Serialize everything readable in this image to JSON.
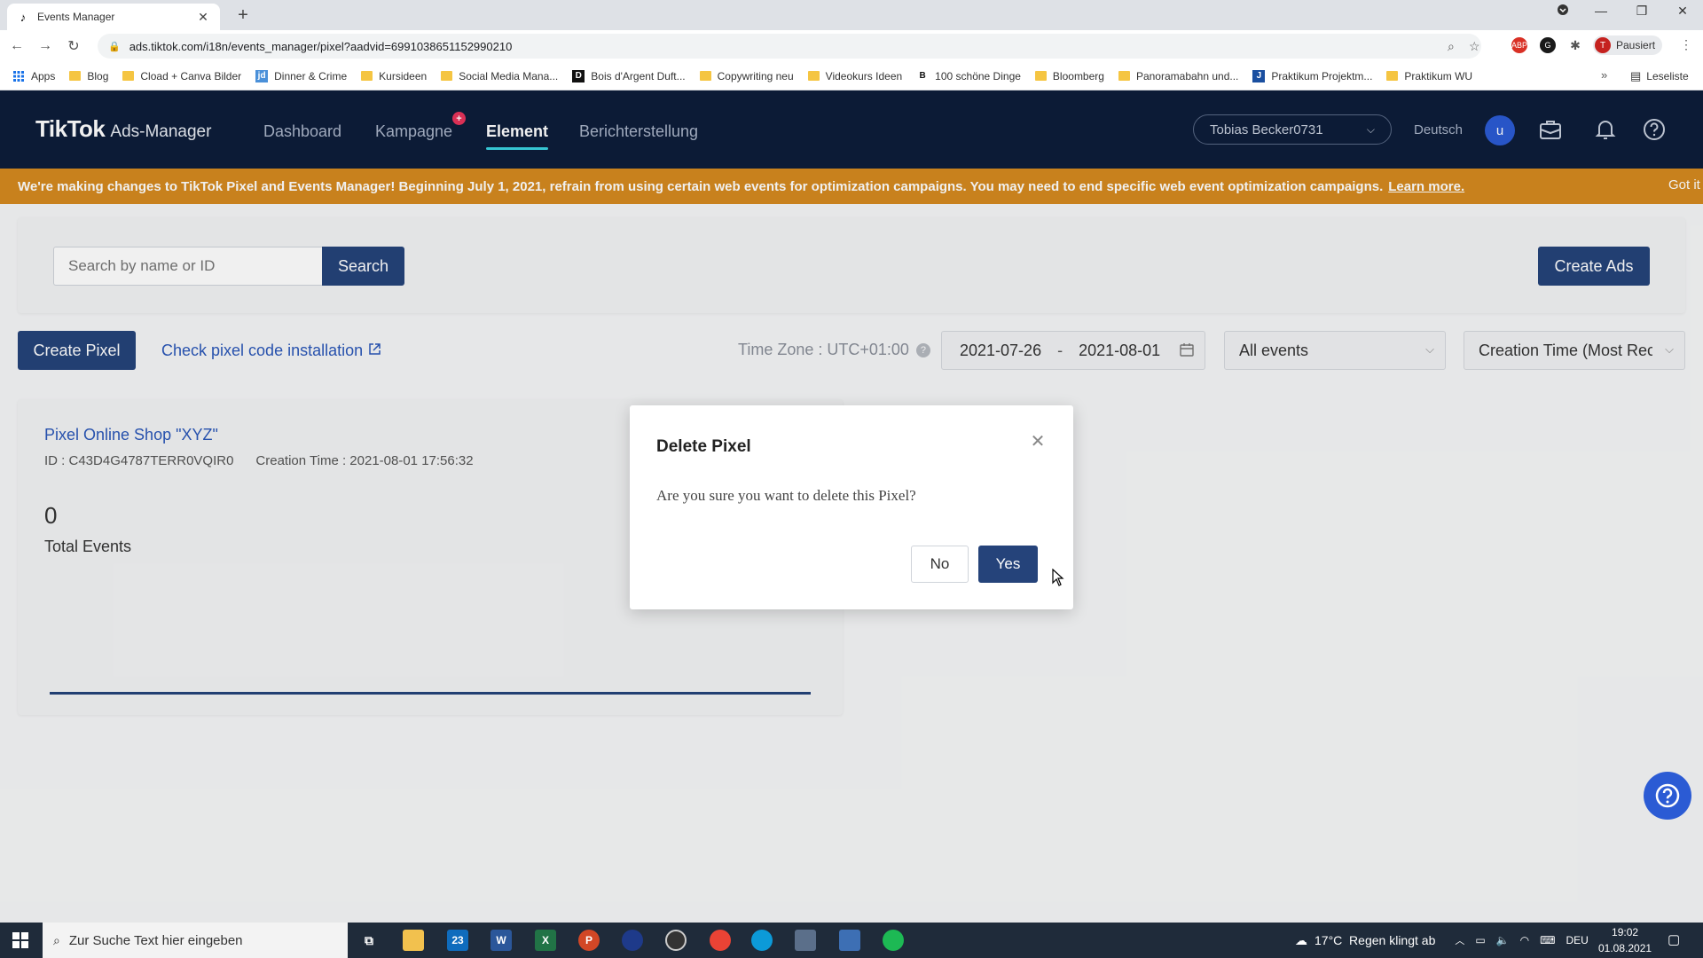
{
  "browser": {
    "tab_title": "Events Manager",
    "url": "ads.tiktok.com/i18n/events_manager/pixel?aadvid=6991038651152990210",
    "profile_label": "Pausiert",
    "profile_initial": "T",
    "ext_abp": "ABP",
    "bookmarks": [
      {
        "label": "Apps",
        "icon": "apps-grid-icon"
      },
      {
        "label": "Blog",
        "icon": "folder-icon"
      },
      {
        "label": "Cload + Canva Bilder",
        "icon": "folder-icon"
      },
      {
        "label": "Dinner & Crime",
        "icon": "site-icon"
      },
      {
        "label": "Kursideen",
        "icon": "folder-icon"
      },
      {
        "label": "Social Media Mana...",
        "icon": "folder-icon"
      },
      {
        "label": "Bois d'Argent Duft...",
        "icon": "site-icon"
      },
      {
        "label": "Copywriting neu",
        "icon": "folder-icon"
      },
      {
        "label": "Videokurs Ideen",
        "icon": "folder-icon"
      },
      {
        "label": "100 schöne Dinge",
        "icon": "site-icon"
      },
      {
        "label": "Bloomberg",
        "icon": "folder-icon"
      },
      {
        "label": "Panoramabahn und...",
        "icon": "folder-icon"
      },
      {
        "label": "Praktikum Projektm...",
        "icon": "site-icon"
      },
      {
        "label": "Praktikum WU",
        "icon": "folder-icon"
      }
    ],
    "bookmark_glyphs": {
      "dinner": "jd",
      "bois": "D",
      "hundred": "B",
      "praktikum": "J"
    },
    "reading_list": "Leseliste",
    "more": "»"
  },
  "header": {
    "brand": "TikTok",
    "brand_sub": "Ads-Manager",
    "nav": [
      "Dashboard",
      "Kampagne",
      "Element",
      "Berichterstellung"
    ],
    "active_nav": "Element",
    "badge": "+",
    "account": "Tobias Becker0731",
    "language": "Deutsch",
    "user_initial": "u"
  },
  "banner": {
    "text_pre": "We're making changes to TikTok Pixel and Events Manager! Beginning ",
    "text_date": "July 1, 2021",
    "text_post": ", refrain from using certain web events for optimization campaigns. You may need to end specific web event optimization campaigns.",
    "link": "Learn more.",
    "dismiss": "Got it"
  },
  "search": {
    "placeholder": "Search by name or ID",
    "button": "Search",
    "create_ads": "Create Ads"
  },
  "toolbar": {
    "create_pixel": "Create Pixel",
    "check_link": "Check pixel code installation",
    "timezone": "Time Zone : UTC+01:00",
    "date_start": "2021-07-26",
    "date_sep": "-",
    "date_end": "2021-08-01",
    "events_filter": "All events",
    "sort": "Creation Time (Most Recent)"
  },
  "pixel": {
    "name": "Pixel Online Shop \"XYZ\"",
    "id": "ID : C43D4G4787TERR0VQIR0",
    "created": "Creation Time : 2021-08-01 17:56:32",
    "total_value": "0",
    "total_label": "Total Events"
  },
  "modal": {
    "title": "Delete Pixel",
    "body": "Are you sure you want to delete this Pixel?",
    "no": "No",
    "yes": "Yes"
  },
  "taskbar": {
    "search_placeholder": "Zur Suche Text hier eingeben",
    "weather": "17°C  Regen klingt ab",
    "lang": "DEU",
    "time": "19:02",
    "date": "01.08.2021",
    "mail_badge": "23"
  },
  "colors": {
    "header_bg": "#0d1d3a",
    "banner_bg": "#d58a1f",
    "primary": "#25437a",
    "link": "#2a57b8",
    "accent_underline": "#3ad2e0"
  }
}
